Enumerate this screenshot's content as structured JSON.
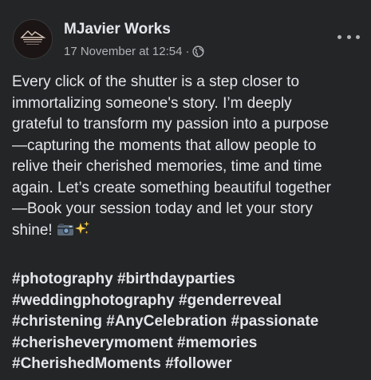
{
  "post": {
    "author": "MJavier Works",
    "date": "17 November at 12:54",
    "separator": "·",
    "privacy_icon": "globe-icon",
    "more_icon": "more-options-icon",
    "body_lines": [
      "Every click of the shutter is a step closer to",
      "immortalizing someone's story. I’m deeply",
      "grateful to transform my passion into a purpose",
      "—capturing the moments that allow people to",
      "relive their cherished memories, time and time",
      "again. Let’s create something beautiful together",
      "—Book your session today and let your story",
      "shine!"
    ],
    "emojis": [
      "camera-emoji",
      "sparkles-emoji"
    ],
    "hashtag_lines": [
      [
        "#photography",
        "#birthdayparties"
      ],
      [
        "#weddingphotography",
        "#genderreveal"
      ],
      [
        "#christening",
        "#AnyCelebration",
        "#passionate"
      ],
      [
        "#cherisheverymoment",
        "#memories"
      ],
      [
        "#CherishedMoments",
        "#follower"
      ]
    ]
  },
  "colors": {
    "background": "#242526",
    "primary_text": "#e4e6eb",
    "secondary_text": "#b0b3b8"
  }
}
